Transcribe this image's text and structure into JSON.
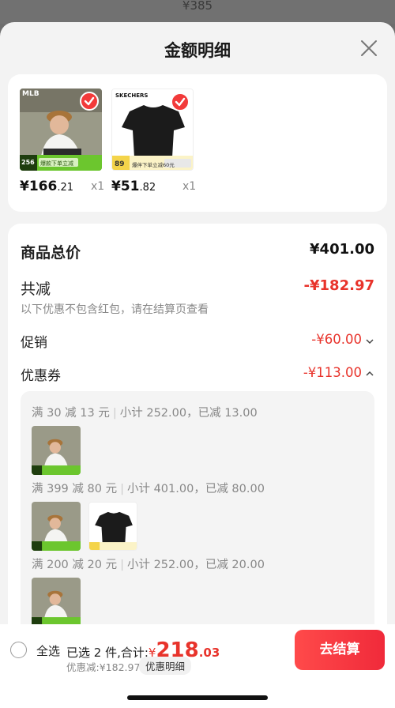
{
  "background": {
    "price_text": "¥385"
  },
  "sheet": {
    "title": "金额明细",
    "close_icon": "close-icon"
  },
  "products": [
    {
      "brand": "MLB",
      "price_int": "¥166",
      "price_dec": ".21",
      "qty": "x1",
      "badge": "256",
      "promo": "爆款下单立减"
    },
    {
      "brand": "SKECHERS",
      "price_int": "¥51",
      "price_dec": ".82",
      "qty": "x1",
      "badge": "89",
      "promo": "爆伴下单立减60元"
    }
  ],
  "summary": {
    "total_label": "商品总价",
    "total_value": "¥401.00",
    "reduce_label": "共减",
    "reduce_value": "-¥182.97",
    "note": "以下优惠不包含红包，请在结算页查看",
    "promo_label": "促销",
    "promo_value": "-¥60.00",
    "coupon_label": "优惠券",
    "coupon_value": "-¥113.00"
  },
  "coupons": [
    {
      "rule": "满 30 减 13 元",
      "detail": "小计 252.00，已减 13.00"
    },
    {
      "rule": "满 399 减 80 元",
      "detail": "小计 401.00，已减 80.00"
    },
    {
      "rule": "满 200 减 20 元",
      "detail": "小计 252.00，已减 20.00"
    }
  ],
  "bottom": {
    "select_all": "全选",
    "selected_text": "已选 2 件,合计:",
    "yen": "¥",
    "total_int": "218",
    "total_dec": ".03",
    "discount_text": "优惠减:¥182.97",
    "detail_button": "优惠明细",
    "checkout_button": "去结算"
  },
  "colors": {
    "accent_red": "#e8332b",
    "sheet_bg": "#f3f3f3",
    "checkout_gradient_start": "#ff4a4a"
  }
}
